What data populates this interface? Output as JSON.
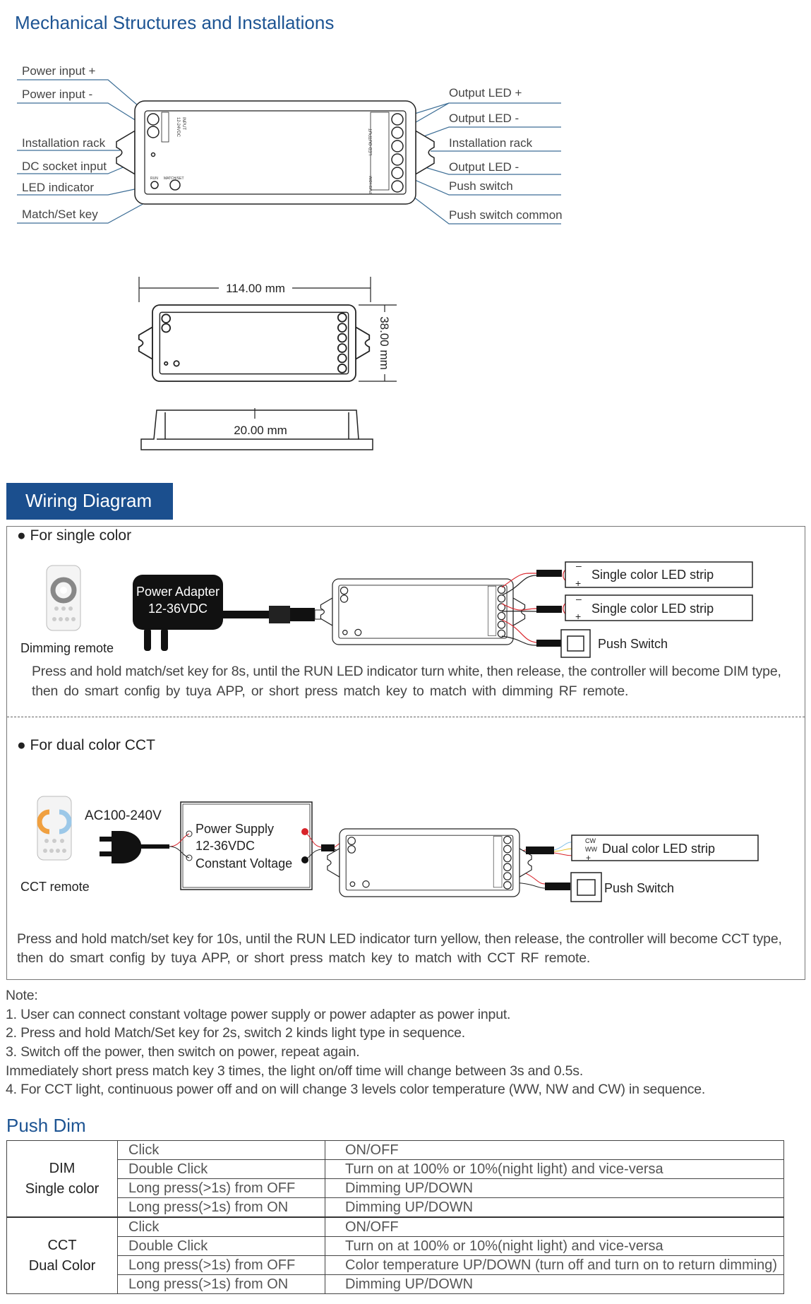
{
  "mechanical": {
    "title": "Mechanical Structures and Installations",
    "left_labels": [
      "Power input +",
      "Power input -",
      "Installation rack",
      "DC socket input",
      "LED indicator",
      "Match/Set key"
    ],
    "right_labels": [
      "Output LED +",
      "Output LED -",
      "Installation rack",
      "Output LED -",
      "Push switch",
      "Push switch common"
    ],
    "device_text": {
      "input": "INPUT",
      "voltage": "12-24VDC",
      "run": "RUN",
      "matchset": "MATCH/SET",
      "led_output": "LED OUTPUT",
      "push_dim": "PUSH-DIM"
    },
    "dim_width": "114.00 mm",
    "dim_height": "38.00 mm",
    "dim_depth": "20.00 mm"
  },
  "wiring": {
    "header": "Wiring Diagram",
    "single": {
      "heading": "For single color",
      "remote_label": "Dimming remote",
      "adapter_line1": "Power Adapter",
      "adapter_line2": "12-36VDC",
      "strip1": "Single color LED strip",
      "strip2": "Single color LED strip",
      "push_switch": "Push Switch",
      "desc_line1": "Press and hold match/set key for 8s, until the RUN LED indicator turn white, then release, the controller will become DIM type,",
      "desc_line2": "then do  smart  config by  tuya  APP,  or  short press match key to match with dimming  RF  remote."
    },
    "cct": {
      "heading": "For dual color CCT",
      "remote_label": "CCT remote",
      "ac_label": "AC100-240V",
      "psu_line1": "Power Supply",
      "psu_line2": "12-36VDC",
      "psu_line3": "Constant Voltage",
      "strip": "Dual color LED strip",
      "strip_cw": "CW",
      "strip_ww": "WW",
      "push_switch": "Push Switch",
      "desc_line1": "Press and hold match/set key for 10s, until the RUN LED indicator turn yellow, then release, the controller will become CCT type,",
      "desc_line2": "then do  smart  config by  tuya  APP,  or  short press match key to match  with CCT  RF  remote."
    }
  },
  "notes": {
    "heading": "Note:",
    "lines": [
      "1. User can connect constant voltage power supply or power adapter as power input.",
      "2. Press and hold Match/Set key for 2s, switch 2 kinds light type in sequence.",
      "3. Switch off the power, then switch on power, repeat again.",
      "Immediately short press match key 3 times, the light on/off time will change between 3s and 0.5s.",
      "4. For CCT light, continuous power off and on will change 3 levels color temperature (WW, NW and CW) in sequence."
    ]
  },
  "push_dim": {
    "title": "Push Dim",
    "groups": [
      {
        "name_line1": "DIM",
        "name_line2": "Single color",
        "rows": [
          {
            "action": "Click",
            "function": "ON/OFF"
          },
          {
            "action": "Double Click",
            "function": "Turn on at 100% or 10%(night light) and vice-versa"
          },
          {
            "action": "Long press(>1s) from OFF",
            "function": "Dimming UP/DOWN"
          },
          {
            "action": "Long press(>1s) from ON",
            "function": "Dimming UP/DOWN"
          }
        ]
      },
      {
        "name_line1": "CCT",
        "name_line2": "Dual Color",
        "rows": [
          {
            "action": "Click",
            "function": "ON/OFF"
          },
          {
            "action": "Double Click",
            "function": "Turn on at 100% or 10%(night light) and vice-versa"
          },
          {
            "action": "Long press(>1s) from OFF",
            "function": "Color temperature UP/DOWN (turn off and turn on to return dimming)"
          },
          {
            "action": "Long press(>1s) from ON",
            "function": "Dimming UP/DOWN"
          }
        ]
      }
    ]
  },
  "colors": {
    "brand_blue": "#1b4f8e",
    "leader_line": "#3d6e96",
    "wire_red": "#d9232a"
  }
}
